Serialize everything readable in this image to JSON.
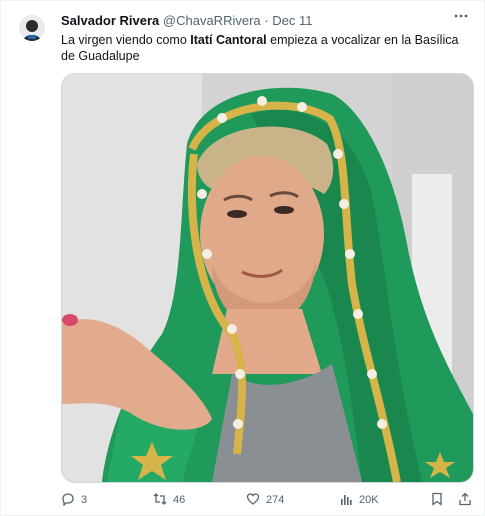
{
  "author": {
    "name": "Salvador Rivera",
    "handle": "@ChavaRRivera",
    "separator": "·",
    "date": "Dec 11"
  },
  "tweet": {
    "text_before": "La virgen viendo como ",
    "text_bold": "Itatí Cantoral",
    "text_after": " empieza a vocalizar en la Basílica de Guadalupe"
  },
  "media": {
    "description": "photo"
  },
  "actions": {
    "replies": "3",
    "retweets": "46",
    "likes": "274",
    "views": "20K"
  },
  "icons": {
    "more": "more-icon",
    "reply": "reply-icon",
    "retweet": "retweet-icon",
    "like": "like-icon",
    "views": "views-icon",
    "bookmark": "bookmark-icon",
    "share": "share-icon"
  },
  "colors": {
    "text": "#0f1419",
    "secondary": "#536471",
    "veil_green": "#1f9a5b",
    "gold_trim": "#d6b44a"
  }
}
